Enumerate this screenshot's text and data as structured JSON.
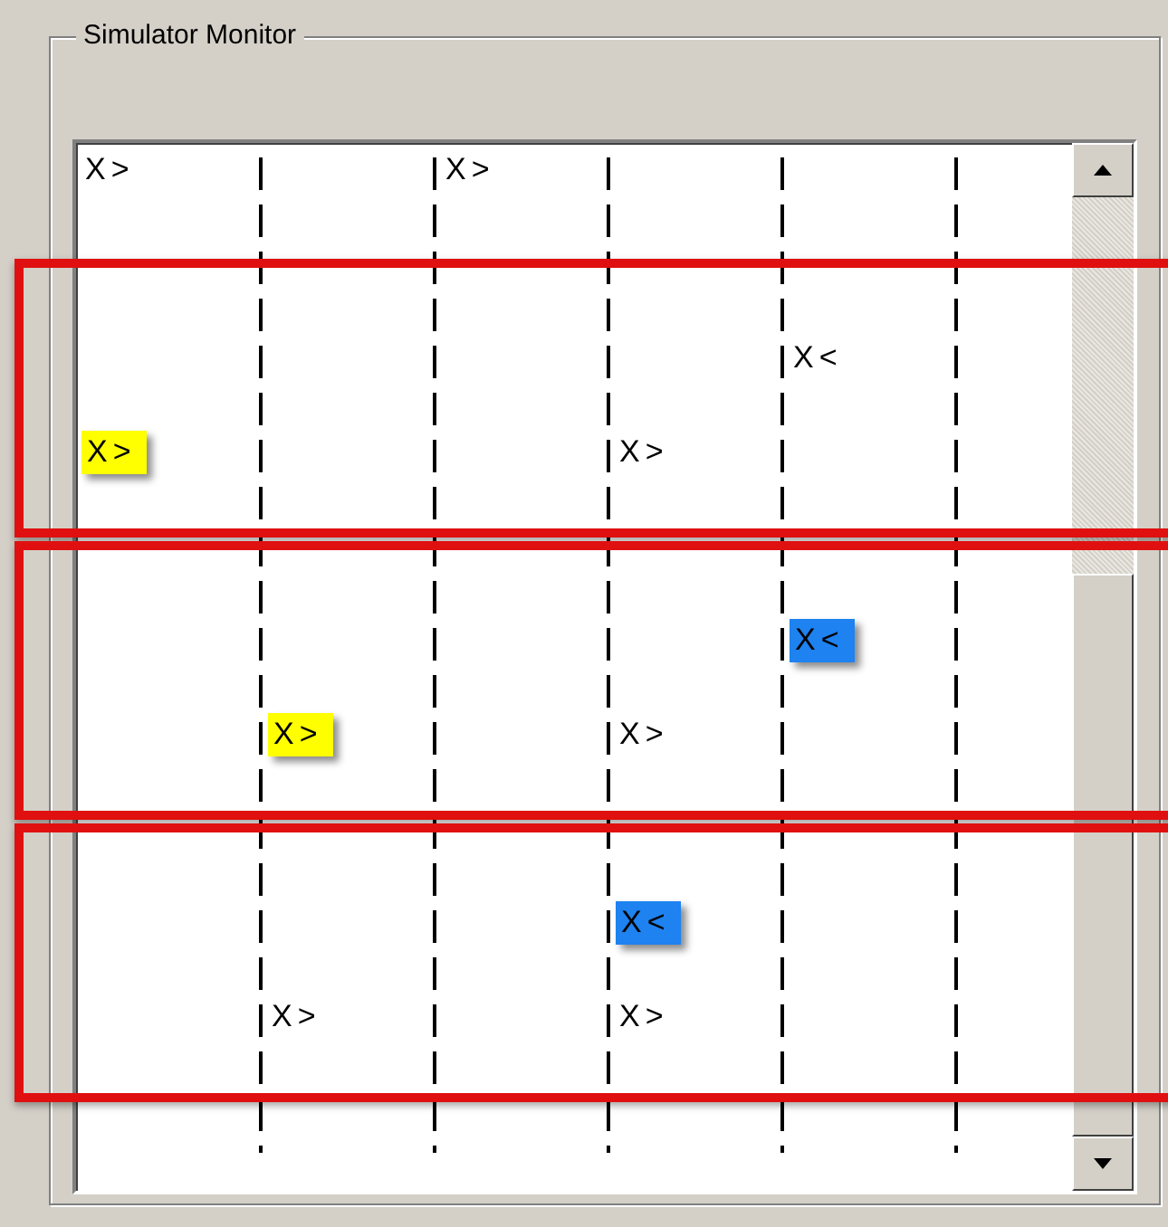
{
  "group_box": {
    "title": "Simulator Monitor"
  },
  "monitor": {
    "rows_before": [
      {
        "cells": [
          {
            "text": "X>"
          },
          null,
          {
            "text": "X>"
          },
          null,
          null,
          null
        ]
      },
      {
        "cells": [
          null,
          null,
          null,
          null,
          null,
          null
        ]
      }
    ],
    "highlighted_sections": [
      {
        "rows": [
          {
            "cells": [
              null,
              null,
              null,
              null,
              null,
              null
            ]
          },
          {
            "cells": [
              null,
              null,
              null,
              null,
              null,
              null
            ]
          },
          {
            "cells": [
              null,
              null,
              null,
              null,
              {
                "text": "X<"
              },
              null
            ]
          },
          {
            "cells": [
              null,
              null,
              null,
              null,
              null,
              null
            ]
          },
          {
            "cells": [
              {
                "text": "X>",
                "color": "#ffff00"
              },
              null,
              null,
              {
                "text": "X>"
              },
              null,
              null
            ]
          },
          {
            "cells": [
              null,
              null,
              null,
              null,
              null,
              null
            ]
          }
        ]
      },
      {
        "rows": [
          {
            "cells": [
              null,
              null,
              null,
              null,
              null,
              null
            ]
          },
          {
            "cells": [
              null,
              null,
              null,
              null,
              null,
              null
            ]
          },
          {
            "cells": [
              null,
              null,
              null,
              null,
              {
                "text": "X<",
                "color": "#1e82f0"
              },
              null
            ]
          },
          {
            "cells": [
              null,
              null,
              null,
              null,
              null,
              null
            ]
          },
          {
            "cells": [
              null,
              {
                "text": "X>",
                "color": "#ffff00"
              },
              null,
              {
                "text": "X>"
              },
              null,
              null
            ]
          },
          {
            "cells": [
              null,
              null,
              null,
              null,
              null,
              null
            ]
          }
        ]
      },
      {
        "rows": [
          {
            "cells": [
              null,
              null,
              null,
              null,
              null,
              null
            ]
          },
          {
            "cells": [
              null,
              null,
              null,
              null,
              null,
              null
            ]
          },
          {
            "cells": [
              null,
              null,
              null,
              {
                "text": "X<",
                "color": "#1e82f0"
              },
              null,
              null
            ]
          },
          {
            "cells": [
              null,
              null,
              null,
              null,
              null,
              null
            ]
          },
          {
            "cells": [
              null,
              {
                "text": "X>"
              },
              null,
              {
                "text": "X>"
              },
              null,
              null
            ]
          },
          {
            "cells": [
              null,
              null,
              null,
              null,
              null,
              null
            ]
          }
        ]
      }
    ],
    "rows_after": [
      {
        "cells": [
          null,
          null,
          null,
          null,
          null,
          null
        ]
      }
    ]
  }
}
